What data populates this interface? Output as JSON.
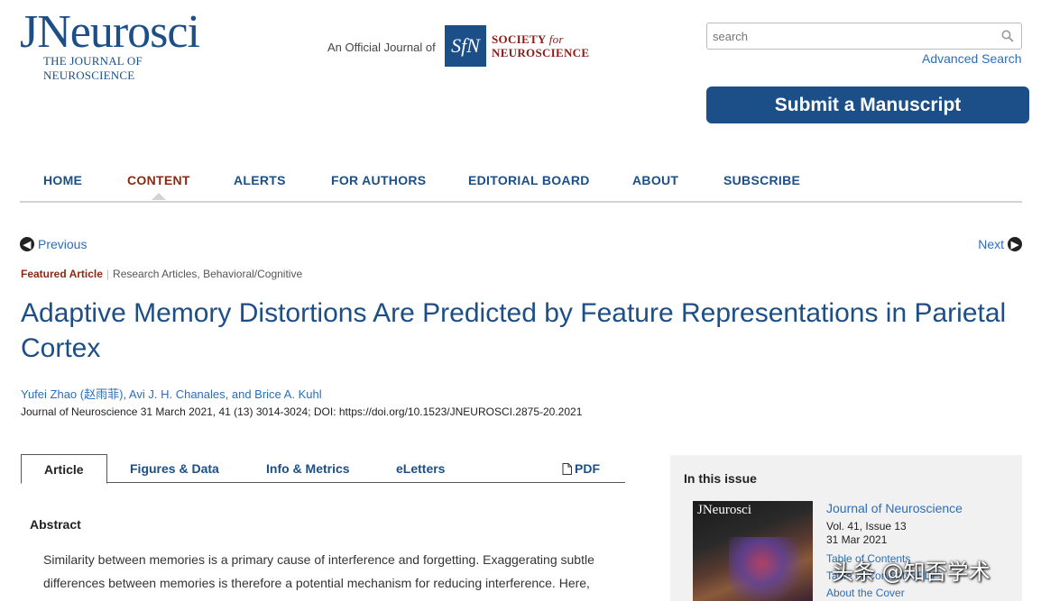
{
  "header": {
    "logo_main": "JNeurosci",
    "logo_sub": "THE JOURNAL OF NEUROSCIENCE",
    "official_text": "An Official Journal of",
    "sfn_mark": "SfN",
    "sfn_line1": "SOCIETY",
    "sfn_for": "for",
    "sfn_line2": "NEUROSCIENCE",
    "search_placeholder": "search",
    "advanced_search": "Advanced Search",
    "submit_button": "Submit a Manuscript"
  },
  "nav": {
    "items": [
      "HOME",
      "CONTENT",
      "ALERTS",
      "FOR AUTHORS",
      "EDITORIAL BOARD",
      "ABOUT",
      "SUBSCRIBE"
    ],
    "active": "CONTENT"
  },
  "pager": {
    "previous": "Previous",
    "next": "Next"
  },
  "article": {
    "featured": "Featured Article",
    "section": "Research Articles, Behavioral/Cognitive",
    "title": "Adaptive Memory Distortions Are Predicted by Feature Representations in Parietal Cortex",
    "authors": "Yufei Zhao (赵雨菲), Avi J. H. Chanales, and Brice A. Kuhl",
    "citation": "Journal of Neuroscience 31 March 2021, 41 (13) 3014-3024; DOI: https://doi.org/10.1523/JNEUROSCI.2875-20.2021"
  },
  "tabs": {
    "article": "Article",
    "figures": "Figures & Data",
    "info": "Info & Metrics",
    "eletters": "eLetters",
    "pdf": "PDF"
  },
  "abstract": {
    "heading": "Abstract",
    "text": "Similarity between memories is a primary cause of interference and forgetting. Exaggerating subtle differences between memories is therefore a potential mechanism for reducing interference. Here,"
  },
  "sidebar": {
    "heading": "In this issue",
    "cover_title": "JNeurosci",
    "journal": "Journal of Neuroscience",
    "volume": "Vol. 41, Issue 13",
    "date": "31 Mar 2021",
    "links": [
      "Table of Contents",
      "Table of Contents (PDF)",
      "About the Cover"
    ]
  },
  "watermark": "头条 @知否学术",
  "colors": {
    "brand_blue": "#1c4f87",
    "link_blue": "#2a6ebb",
    "accent_red": "#8b2a10"
  }
}
